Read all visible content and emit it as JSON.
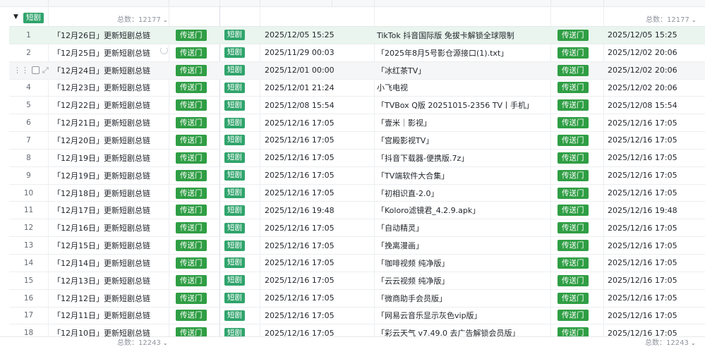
{
  "group": {
    "tag": "短剧",
    "count_label": "总数：",
    "count": "12177"
  },
  "footer": {
    "count_label": "总数：",
    "count": "12243"
  },
  "icons": {
    "collapse": "caret-down-icon",
    "drag": "drag-handle-icon",
    "expand": "expand-icon"
  },
  "colors": {
    "tag_green": "#30a46c",
    "button_green": "#2f9e44",
    "selected_row": "#e9f5ee"
  },
  "rows": [
    {
      "index": "1",
      "title": "「12月26日」更新短剧总链",
      "portal": "传送门",
      "tag": "短剧",
      "date1": "2025/12/05 15:25",
      "name": "TikTok 抖音国际版 免拔卡解锁全球限制",
      "portal2": "传送门",
      "date2": "2025/12/05 15:25"
    },
    {
      "index": "2",
      "title": "「12月25日」更新短剧总链",
      "portal": "传送门",
      "tag": "短剧",
      "date1": "2025/11/29 00:03",
      "name": "「2025年8月5号影仓源接口(1).txt」",
      "portal2": "传送门",
      "date2": "2025/12/02 20:06"
    },
    {
      "index": "",
      "title": "「12月24日」更新短剧总链",
      "portal": "传送门",
      "tag": "短剧",
      "date1": "2025/12/01 00:00",
      "name": "「冰红茶TV」",
      "portal2": "传送门",
      "date2": "2025/12/02 20:06"
    },
    {
      "index": "4",
      "title": "「12月23日」更新短剧总链",
      "portal": "传送门",
      "tag": "短剧",
      "date1": "2025/12/01 21:24",
      "name": "小飞电视",
      "portal2": "传送门",
      "date2": "2025/12/02 20:06"
    },
    {
      "index": "5",
      "title": "「12月22日」更新短剧总链",
      "portal": "传送门",
      "tag": "短剧",
      "date1": "2025/12/08 15:54",
      "name": "「TVBox Q版 20251015-2356 TV丨手机」",
      "portal2": "传送门",
      "date2": "2025/12/08 15:54"
    },
    {
      "index": "6",
      "title": "「12月21日」更新短剧总链",
      "portal": "传送门",
      "tag": "短剧",
      "date1": "2025/12/16 17:05",
      "name": "「壹米｜影视」",
      "portal2": "传送门",
      "date2": "2025/12/16 17:05"
    },
    {
      "index": "7",
      "title": "「12月20日」更新短剧总链",
      "portal": "传送门",
      "tag": "短剧",
      "date1": "2025/12/16 17:05",
      "name": "「宫殿影视TV」",
      "portal2": "传送门",
      "date2": "2025/12/16 17:05"
    },
    {
      "index": "8",
      "title": "「12月19日」更新短剧总链",
      "portal": "传送门",
      "tag": "短剧",
      "date1": "2025/12/16 17:05",
      "name": "「抖音下载器-便携版.7z」",
      "portal2": "传送门",
      "date2": "2025/12/16 17:05"
    },
    {
      "index": "9",
      "title": "「12月19日」更新短剧总链",
      "portal": "传送门",
      "tag": "短剧",
      "date1": "2025/12/16 17:05",
      "name": "「TV端软件大合集」",
      "portal2": "传送门",
      "date2": "2025/12/16 17:05"
    },
    {
      "index": "10",
      "title": "「12月18日」更新短剧总链",
      "portal": "传送门",
      "tag": "短剧",
      "date1": "2025/12/16 17:05",
      "name": "「初相识直-2.0」",
      "portal2": "传送门",
      "date2": "2025/12/16 17:05"
    },
    {
      "index": "11",
      "title": "「12月17日」更新短剧总链",
      "portal": "传送门",
      "tag": "短剧",
      "date1": "2025/12/16 19:48",
      "name": "「Koloro滤镜君_4.2.9.apk」",
      "portal2": "传送门",
      "date2": "2025/12/16 19:48"
    },
    {
      "index": "12",
      "title": "「12月16日」更新短剧总链",
      "portal": "传送门",
      "tag": "短剧",
      "date1": "2025/12/16 17:05",
      "name": "「自动精灵」",
      "portal2": "传送门",
      "date2": "2025/12/16 17:05"
    },
    {
      "index": "13",
      "title": "「12月15日」更新短剧总链",
      "portal": "传送门",
      "tag": "短剧",
      "date1": "2025/12/16 17:05",
      "name": "「挽离漫画」",
      "portal2": "传送门",
      "date2": "2025/12/16 17:05"
    },
    {
      "index": "14",
      "title": "「12月14日」更新短剧总链",
      "portal": "传送门",
      "tag": "短剧",
      "date1": "2025/12/16 17:05",
      "name": "「咖啡视频 纯净版」",
      "portal2": "传送门",
      "date2": "2025/12/16 17:05"
    },
    {
      "index": "15",
      "title": "「12月13日」更新短剧总链",
      "portal": "传送门",
      "tag": "短剧",
      "date1": "2025/12/16 17:05",
      "name": "「云云视频 纯净版」",
      "portal2": "传送门",
      "date2": "2025/12/16 17:05"
    },
    {
      "index": "16",
      "title": "「12月12日」更新短剧总链",
      "portal": "传送门",
      "tag": "短剧",
      "date1": "2025/12/16 17:05",
      "name": "「微商助手会员版」",
      "portal2": "传送门",
      "date2": "2025/12/16 17:05"
    },
    {
      "index": "17",
      "title": "「12月11日」更新短剧总链",
      "portal": "传送门",
      "tag": "短剧",
      "date1": "2025/12/16 17:05",
      "name": "「网易云音乐显示灰色vip版」",
      "portal2": "传送门",
      "date2": "2025/12/16 17:05"
    },
    {
      "index": "18",
      "title": "「12月10日」更新短剧总链",
      "portal": "传送门",
      "tag": "短剧",
      "date1": "2025/12/16 17:05",
      "name": "「彩云天气 v7.49.0 去广告解锁会员版」",
      "portal2": "传送门",
      "date2": "2025/12/16 17:05"
    }
  ]
}
